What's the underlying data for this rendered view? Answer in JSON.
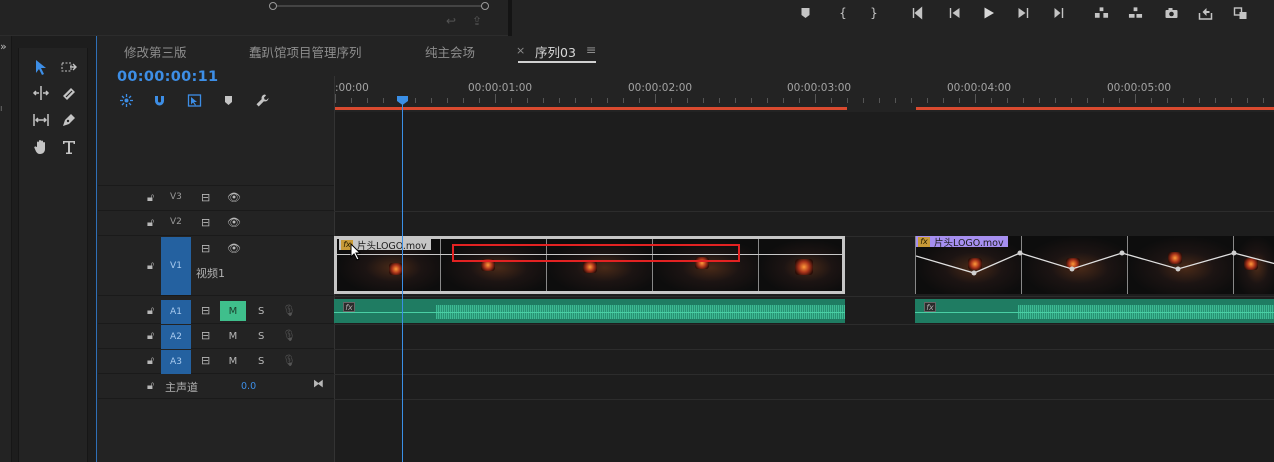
{
  "sequence_tabs": [
    {
      "label": "修改第三版",
      "active": false
    },
    {
      "label": "蠢趴馆项目管理序列",
      "active": false
    },
    {
      "label": "纯主会场",
      "active": false
    },
    {
      "label": "序列03",
      "active": true,
      "close_glyph": "×",
      "menu_glyph": "≡"
    }
  ],
  "timecode": "00:00:00:11",
  "ruler_labels": [
    ":00:00",
    "00:00:01:00",
    "00:00:02:00",
    "00:00:03:00",
    "00:00:04:00",
    "00:00:05:00"
  ],
  "tracks": {
    "video": [
      {
        "id": "V3",
        "lock": true
      },
      {
        "id": "V2",
        "lock": true
      },
      {
        "id": "V1",
        "lock": true,
        "name": "视频1"
      }
    ],
    "audio": [
      {
        "id": "A1",
        "mute_label": "M",
        "solo_label": "S",
        "mute_on": true
      },
      {
        "id": "A2",
        "mute_label": "M",
        "solo_label": "S",
        "mute_on": false
      },
      {
        "id": "A3",
        "mute_label": "M",
        "solo_label": "S",
        "mute_on": false
      }
    ],
    "master": {
      "label": "主声道",
      "value": "0.0"
    }
  },
  "clips": {
    "video_clip_1": {
      "name": "片头LOGO.mov",
      "fx": "fx"
    },
    "video_clip_2": {
      "name": "片头LOGO.mov",
      "fx": "fx"
    },
    "audio_fx": "fx"
  },
  "colors": {
    "accent": "#3d8ee6",
    "work_area_bar": "#d94a2f",
    "audio_clip": "#1f7c62",
    "selected_clip_border": "#c6c6c6",
    "clip2_label": "#a68ff0",
    "highlight_box": "#e32222"
  }
}
